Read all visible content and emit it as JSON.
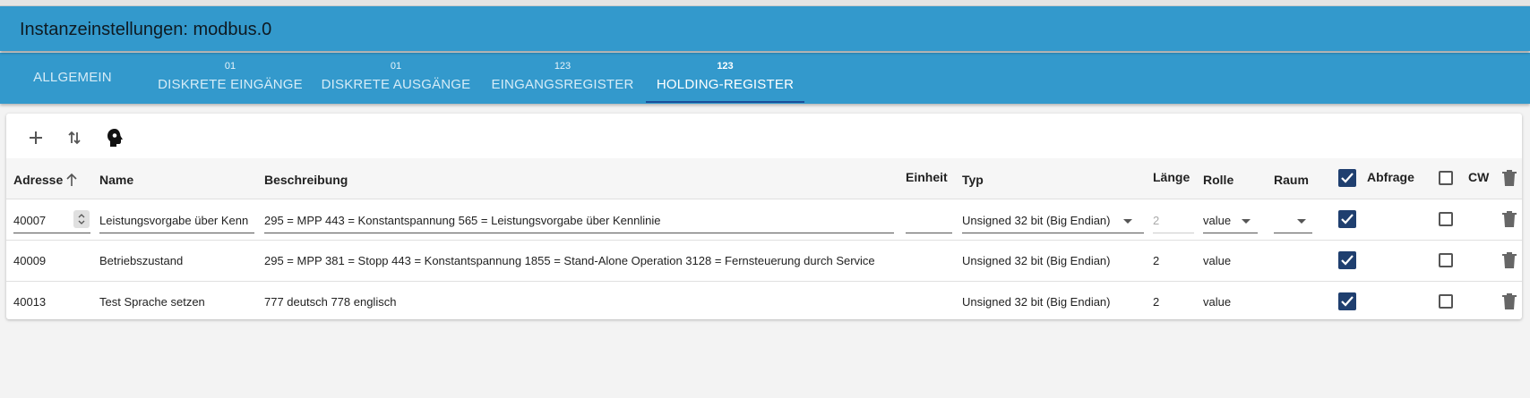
{
  "header": {
    "title": "Instanzeinstellungen: modbus.0"
  },
  "tabs": [
    {
      "badge": "",
      "label": "ALLGEMEIN"
    },
    {
      "badge": "01",
      "label": "DISKRETE EINGÄNGE"
    },
    {
      "badge": "01",
      "label": "DISKRETE AUSGÄNGE"
    },
    {
      "badge": "123",
      "label": "EINGANGSREGISTER"
    },
    {
      "badge": "123",
      "label": "HOLDING-REGISTER",
      "active": true
    }
  ],
  "toolbar": {
    "add_icon": "plus-icon",
    "sort_icon": "sort-arrows-icon",
    "mode_icon": "head-profile-icon"
  },
  "table": {
    "columns": {
      "address": "Adresse",
      "name": "Name",
      "description": "Beschreibung",
      "unit": "Einheit",
      "type": "Typ",
      "length": "Länge",
      "role": "Rolle",
      "room": "Raum",
      "poll": "Abfrage",
      "cw": "CW"
    },
    "header_checks": {
      "poll": true,
      "cw": false
    },
    "rows": [
      {
        "address": "40007",
        "name": "Leistungsvorgabe über Kenn",
        "description": "295 = MPP 443 = Konstantspannung 565 = Leistungsvorgabe über Kennlinie",
        "unit": "",
        "type": "Unsigned 32 bit (Big Endian)",
        "length": "2",
        "role": "value",
        "room": "",
        "poll": true,
        "cw": false,
        "editing": true
      },
      {
        "address": "40009",
        "name": "Betriebszustand",
        "description": "295 = MPP 381 = Stopp 443 = Konstantspannung 1855 = Stand-Alone Operation 3128 = Fernsteuerung durch Service",
        "unit": "",
        "type": "Unsigned 32 bit (Big Endian)",
        "length": "2",
        "role": "value",
        "room": "",
        "poll": true,
        "cw": false
      },
      {
        "address": "40013",
        "name": "Test Sprache setzen",
        "description": "777 deutsch 778 englisch",
        "unit": "",
        "type": "Unsigned 32 bit (Big Endian)",
        "length": "2",
        "role": "value",
        "room": "",
        "poll": true,
        "cw": false
      }
    ]
  }
}
